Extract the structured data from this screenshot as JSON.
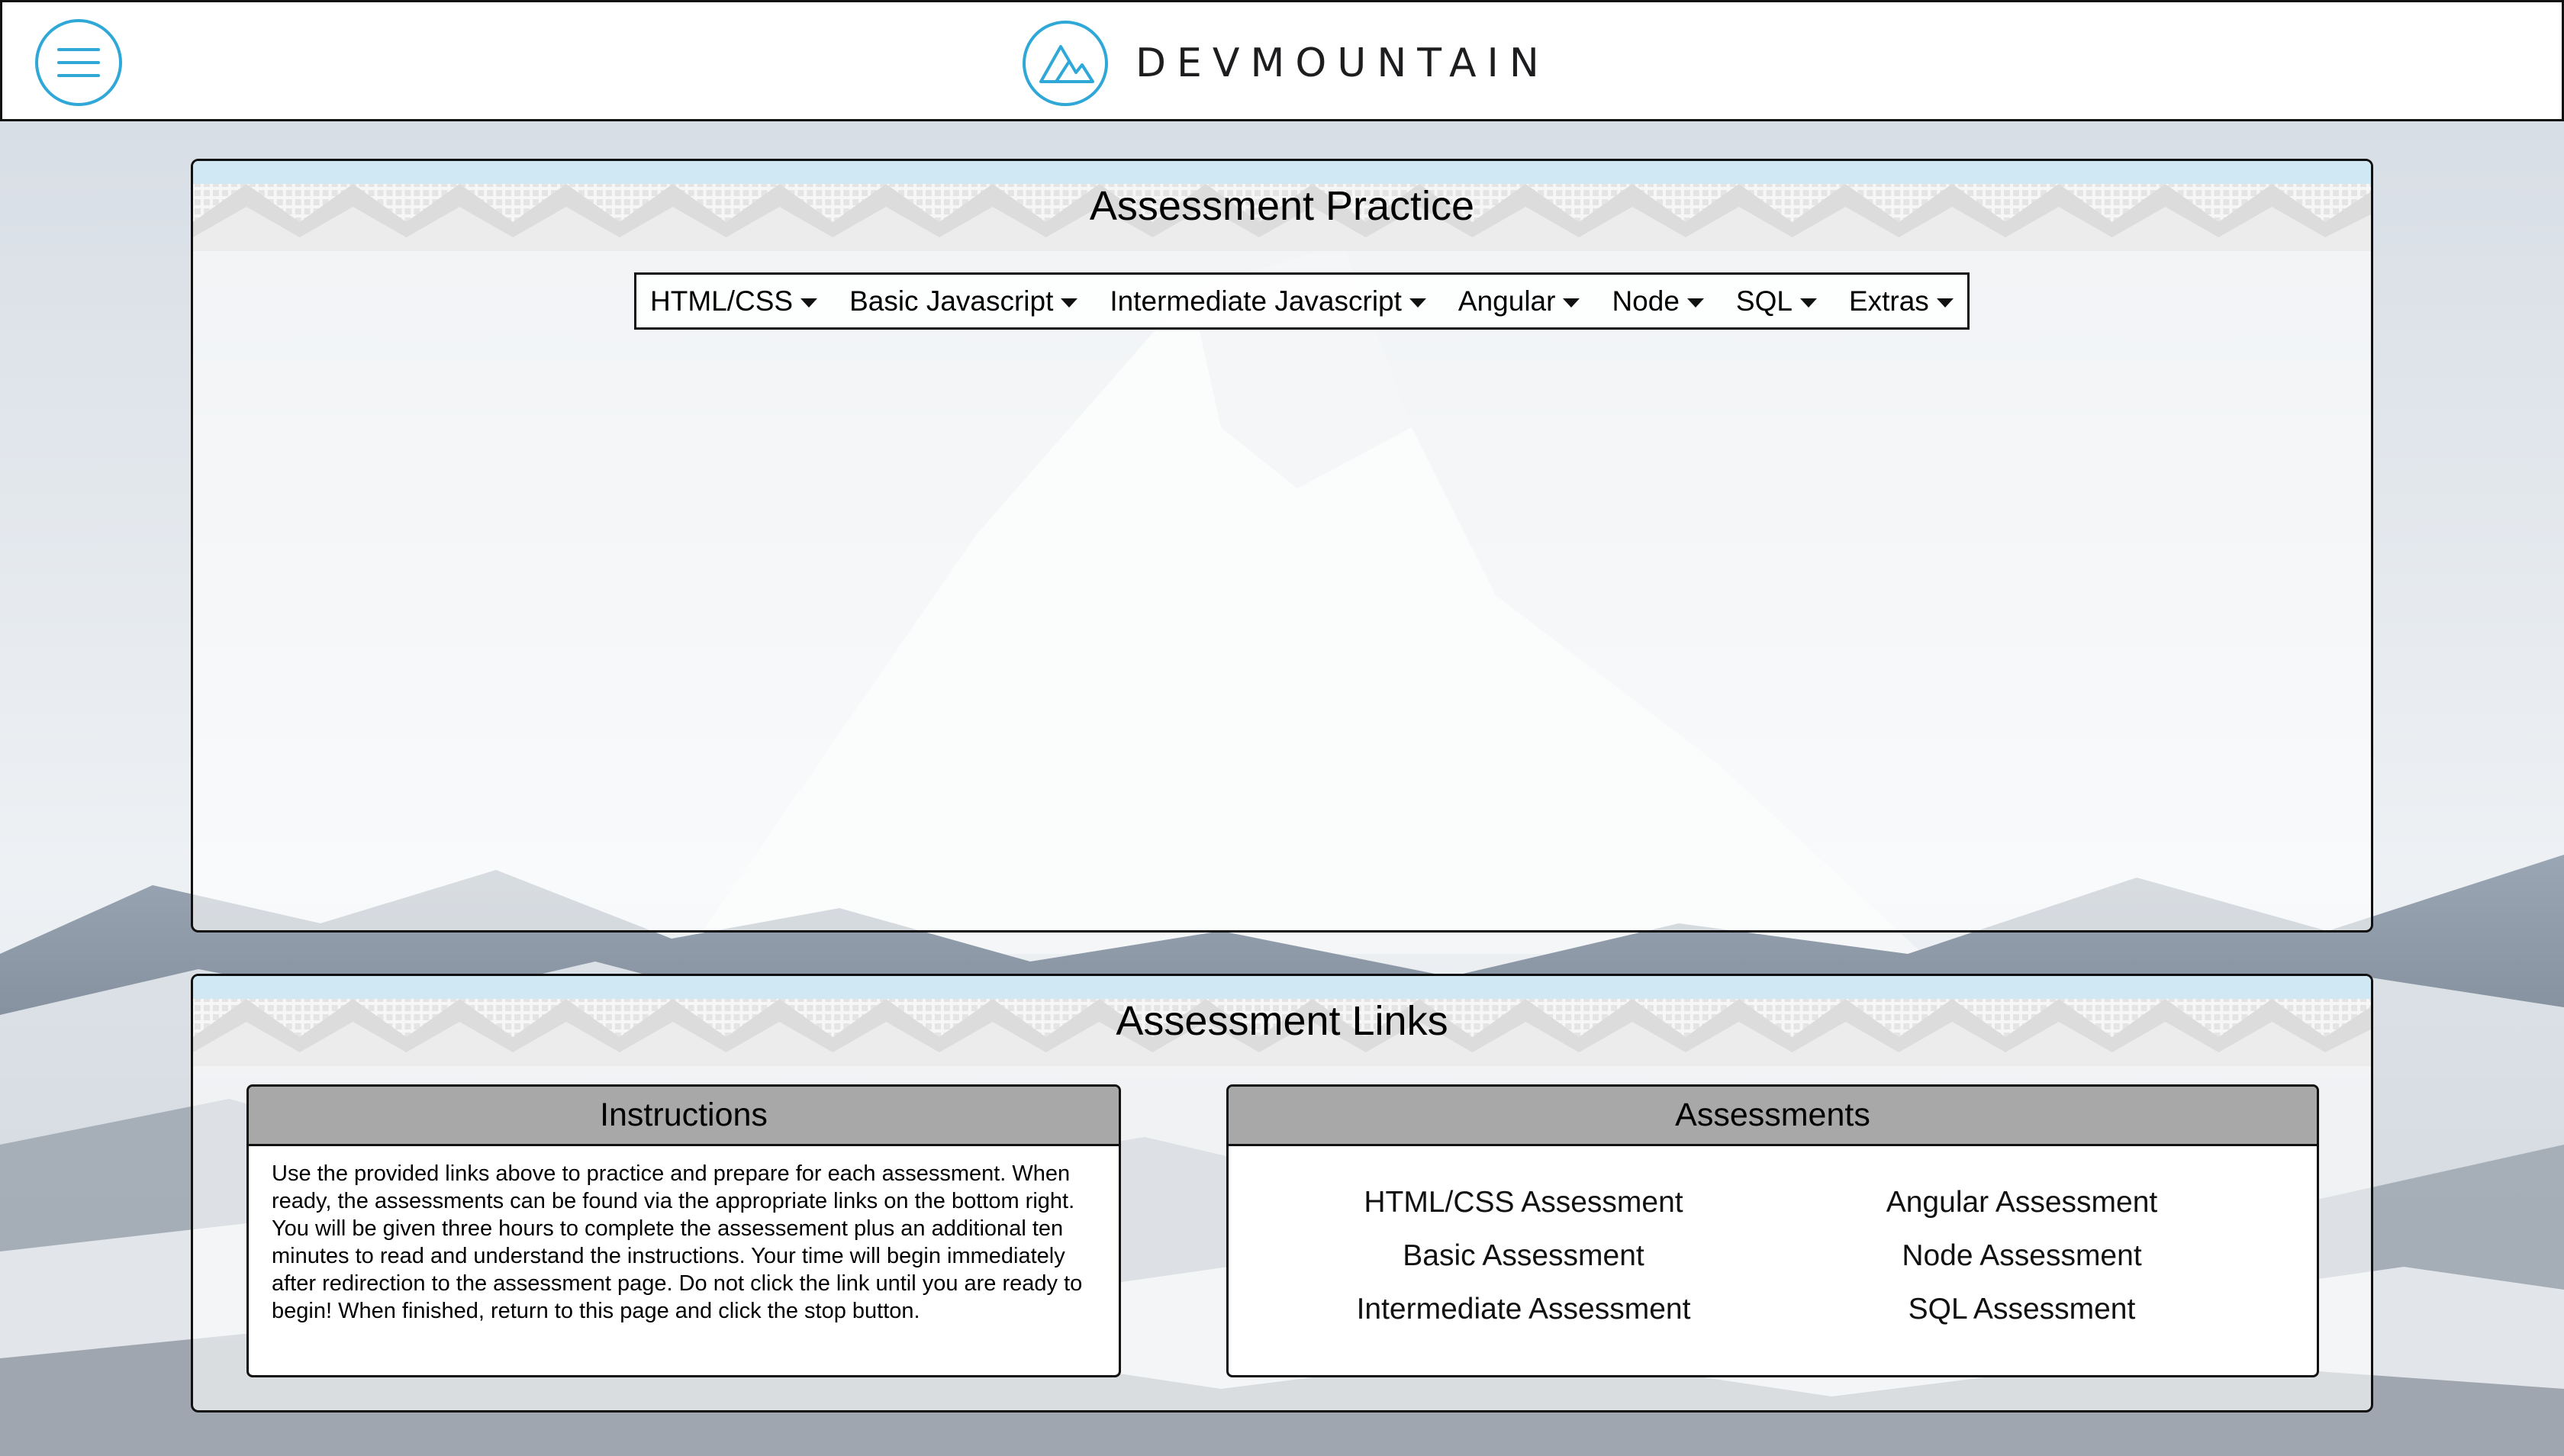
{
  "header": {
    "brand": "DEVMOUNTAIN",
    "accent_color": "#2fa8d8",
    "menu_icon": "hamburger-menu-icon",
    "logo_icon": "mountain-logo-icon"
  },
  "practice": {
    "title": "Assessment Practice",
    "topics": [
      {
        "label": "HTML/CSS"
      },
      {
        "label": "Basic Javascript"
      },
      {
        "label": "Intermediate Javascript"
      },
      {
        "label": "Angular"
      },
      {
        "label": "Node"
      },
      {
        "label": "SQL"
      },
      {
        "label": "Extras"
      }
    ]
  },
  "links": {
    "title": "Assessment Links",
    "instructions": {
      "heading": "Instructions",
      "text": "Use the provided links above to practice and prepare for each assessment. When ready, the assessments can be found via the appropriate links on the bottom right. You will be given three hours to complete the assessement plus an additional ten minutes to read and understand the instructions. Your time will begin immediately after redirection to the assessment page. Do not click the link until you are ready to begin! When finished, return to this page and click the stop button."
    },
    "assessments": {
      "heading": "Assessments",
      "items": [
        "HTML/CSS Assessment",
        "Angular Assessment",
        "Basic Assessment",
        "Node Assessment",
        "Intermediate Assessment",
        "SQL Assessment"
      ]
    }
  }
}
